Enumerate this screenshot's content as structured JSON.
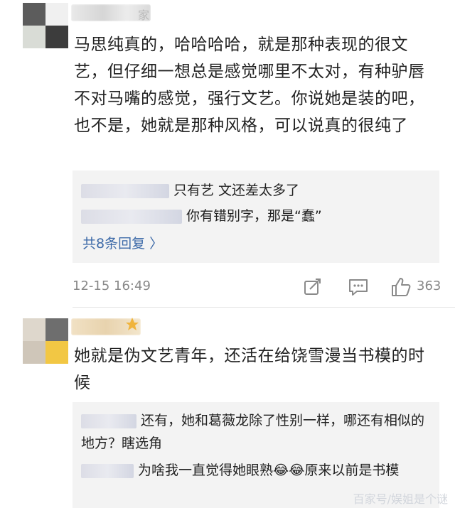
{
  "comments": [
    {
      "username_suffix": "家",
      "text": "马思纯真的，哈哈哈哈，就是那种表现的很文艺，但仔细一想总是感觉哪里不太对，有种驴唇不对马嘴的感觉，强行文艺。你说她是装的吧，也不是，她就是那种风格，可以说真的很纯了",
      "replies": [
        {
          "text": "只有艺 文还差太多了"
        },
        {
          "text": "你有错别字，那是“蠢”"
        }
      ],
      "more_replies": "共8条回复 〉",
      "timestamp": "12-15 16:49",
      "like_count": "363",
      "icons": [
        "share-icon",
        "comment-icon",
        "like-icon"
      ]
    },
    {
      "text": "她就是伪文艺青年，还活在给饶雪漫当书模的时候",
      "replies": [
        {
          "text": "还有，她和葛薇龙除了性别一样，哪还有相似的地方？瞎选角"
        },
        {
          "text": "为啥我一直觉得她眼熟😂😂原来以前是书模"
        }
      ]
    }
  ],
  "watermark": "百家号/娱姐是个谜",
  "colors": {
    "link": "#3d6aa8",
    "meta": "#888888",
    "reply_bg": "#f3f3f3"
  }
}
